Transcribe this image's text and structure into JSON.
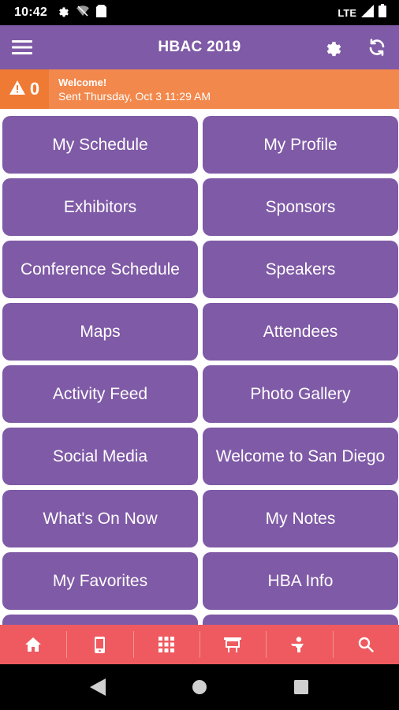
{
  "status_bar": {
    "time": "10:42",
    "network": "LTE",
    "icons_left": [
      "gear-icon",
      "wifi-off-icon",
      "sim-icon"
    ],
    "icons_right": [
      "signal-icon",
      "battery-icon"
    ]
  },
  "header": {
    "title": "HBAC 2019",
    "background": "#7f5aa6",
    "icons": [
      "hamburger-menu-icon",
      "gear-icon",
      "refresh-icon"
    ]
  },
  "alert": {
    "count": "0",
    "title": "Welcome!",
    "subtitle": "Sent Thursday, Oct 3 11:29 AM",
    "background": "#f2884b",
    "icon": "warning-icon"
  },
  "tiles": [
    {
      "label": "My Schedule"
    },
    {
      "label": "My Profile"
    },
    {
      "label": "Exhibitors"
    },
    {
      "label": "Sponsors"
    },
    {
      "label": "Conference Schedule"
    },
    {
      "label": "Speakers"
    },
    {
      "label": "Maps"
    },
    {
      "label": "Attendees"
    },
    {
      "label": "Activity Feed"
    },
    {
      "label": "Photo Gallery"
    },
    {
      "label": "Social Media"
    },
    {
      "label": "Welcome to San Diego"
    },
    {
      "label": "What's On Now"
    },
    {
      "label": "My Notes"
    },
    {
      "label": "My Favorites"
    },
    {
      "label": "HBA Info"
    },
    {
      "label": ""
    },
    {
      "label": ""
    }
  ],
  "tab_bar": {
    "background": "#ee5a5f",
    "tabs": [
      "home-icon",
      "mobile-icon",
      "grid-icon",
      "presentation-icon",
      "speaker-icon",
      "search-icon"
    ]
  },
  "nav_bar": {
    "buttons": [
      "back-icon",
      "home-circle-icon",
      "recents-icon"
    ]
  }
}
